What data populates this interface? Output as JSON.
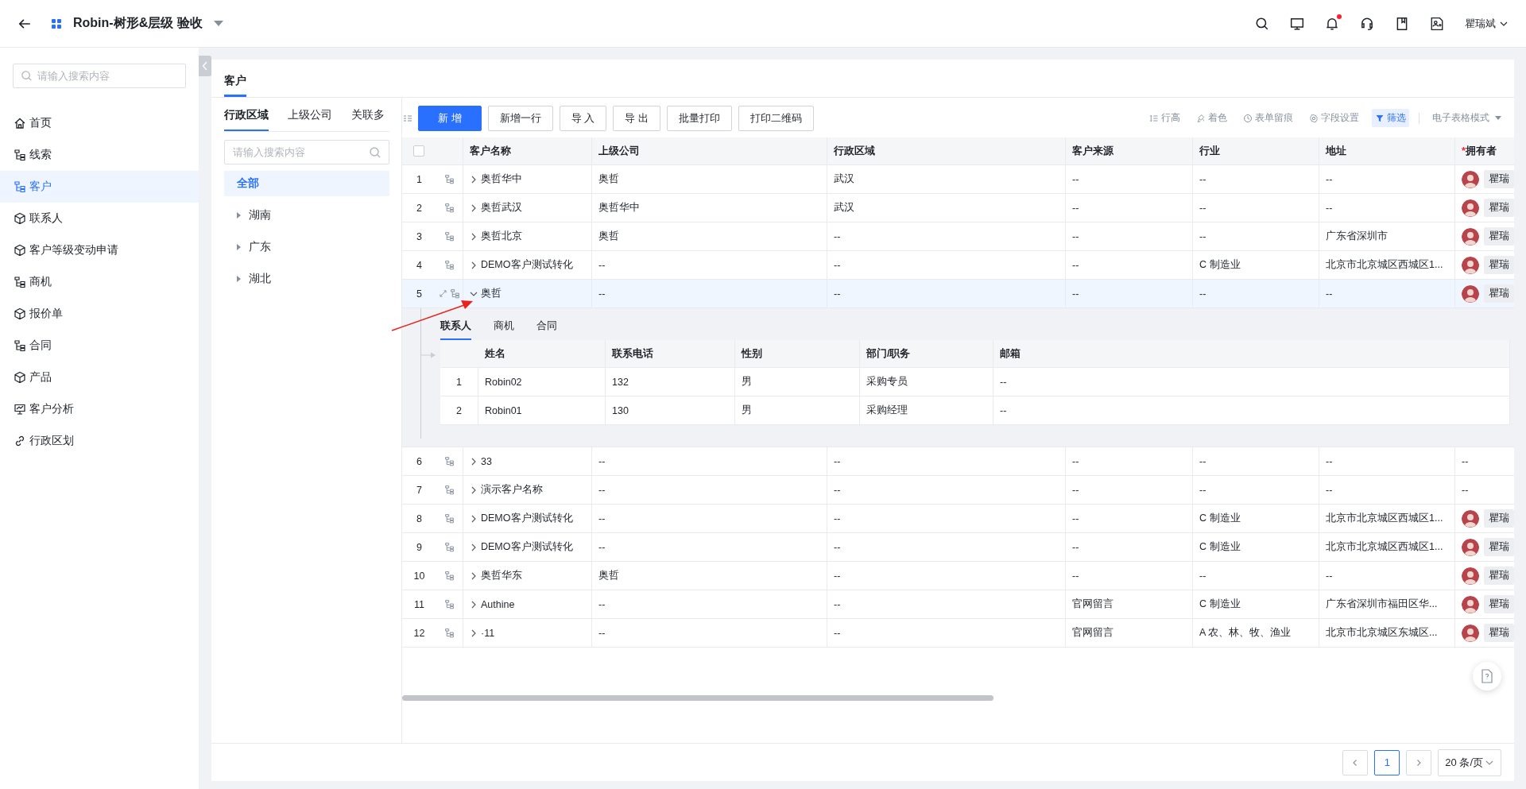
{
  "app_bar": {
    "title": "Robin-树形&层级 验收",
    "user": "瞿瑞斌",
    "notification_dot": true
  },
  "sidebar": {
    "search_placeholder": "请输入搜索内容",
    "items": [
      {
        "label": "首页",
        "kind": "home",
        "selected": false
      },
      {
        "label": "线索",
        "kind": "tree",
        "selected": false
      },
      {
        "label": "客户",
        "kind": "tree",
        "selected": true
      },
      {
        "label": "联系人",
        "kind": "cube",
        "selected": false
      },
      {
        "label": "客户等级变动申请",
        "kind": "cube",
        "selected": false
      },
      {
        "label": "商机",
        "kind": "tree",
        "selected": false
      },
      {
        "label": "报价单",
        "kind": "cube",
        "selected": false
      },
      {
        "label": "合同",
        "kind": "tree",
        "selected": false
      },
      {
        "label": "产品",
        "kind": "cube",
        "selected": false
      },
      {
        "label": "客户分析",
        "kind": "chart",
        "selected": false
      },
      {
        "label": "行政区划",
        "kind": "link",
        "selected": false
      }
    ]
  },
  "page_tabs": [
    {
      "label": "客户",
      "selected": true
    }
  ],
  "filter_panel": {
    "tabs": [
      {
        "label": "行政区域",
        "selected": true
      },
      {
        "label": "上级公司",
        "selected": false
      },
      {
        "label": "关联多",
        "selected": false
      }
    ],
    "search_placeholder": "请输入搜索内容",
    "tree": [
      {
        "label": "全部",
        "kind": "all",
        "selected": true
      },
      {
        "label": "湖南",
        "kind": "node",
        "selected": false,
        "expanded": false
      },
      {
        "label": "广东",
        "kind": "node",
        "selected": false,
        "expanded": false
      },
      {
        "label": "湖北",
        "kind": "node",
        "selected": false,
        "expanded": false
      }
    ]
  },
  "toolbar": {
    "buttons": [
      {
        "label": "新 增",
        "kind": "primary"
      },
      {
        "label": "新增一行",
        "kind": "default"
      },
      {
        "label": "导 入",
        "kind": "default"
      },
      {
        "label": "导 出",
        "kind": "default"
      },
      {
        "label": "批量打印",
        "kind": "default"
      },
      {
        "label": "打印二维码",
        "kind": "default"
      }
    ],
    "tools": [
      {
        "label": "行高",
        "kind": "lines",
        "selected": false
      },
      {
        "label": "着色",
        "kind": "brush",
        "selected": false
      },
      {
        "label": "表单留痕",
        "kind": "clock",
        "selected": false
      },
      {
        "label": "字段设置",
        "kind": "gear",
        "selected": false
      },
      {
        "label": "筛选",
        "kind": "filter",
        "selected": true
      }
    ],
    "mode": "电子表格模式"
  },
  "table": {
    "select_all_checked": false,
    "columns": [
      {
        "label": "客户名称"
      },
      {
        "label": "上级公司"
      },
      {
        "label": "行政区域"
      },
      {
        "label": "客户来源"
      },
      {
        "label": "行业"
      },
      {
        "label": "地址"
      },
      {
        "label": "拥有者",
        "required_mark": "*"
      }
    ],
    "rows": [
      {
        "index": "1",
        "expanded": false,
        "hovered": false,
        "cells": [
          "奥哲华中",
          "奥哲",
          "武汉",
          "--",
          "--",
          "--"
        ],
        "owner": {
          "avatar": true,
          "name": "瞿瑞"
        }
      },
      {
        "index": "2",
        "expanded": false,
        "hovered": false,
        "cells": [
          "奥哲武汉",
          "奥哲华中",
          "武汉",
          "--",
          "--",
          "--"
        ],
        "owner": {
          "avatar": true,
          "name": "瞿瑞"
        }
      },
      {
        "index": "3",
        "expanded": false,
        "hovered": false,
        "cells": [
          "奥哲北京",
          "奥哲",
          "--",
          "--",
          "--",
          "广东省深圳市"
        ],
        "owner": {
          "avatar": true,
          "name": "瞿瑞"
        }
      },
      {
        "index": "4",
        "expanded": false,
        "hovered": false,
        "cells": [
          "DEMO客户测试转化",
          "--",
          "--",
          "--",
          "C 制造业",
          "北京市北京城区西城区1..."
        ],
        "owner": {
          "avatar": true,
          "name": "瞿瑞"
        }
      },
      {
        "index": "5",
        "expanded": true,
        "hovered": true,
        "cells": [
          "奥哲",
          "--",
          "--",
          "--",
          "--",
          "--"
        ],
        "owner": {
          "avatar": true,
          "name": "瞿瑞"
        },
        "detail": {
          "tabs": [
            {
              "label": "联系人",
              "selected": true
            },
            {
              "label": "商机",
              "selected": false
            },
            {
              "label": "合同",
              "selected": false
            }
          ],
          "columns": [
            "姓名",
            "联系电话",
            "性别",
            "部门/职务",
            "邮箱"
          ],
          "rows": [
            {
              "index": "1",
              "cells": [
                "Robin02",
                "132",
                "男",
                "采购专员",
                "--"
              ]
            },
            {
              "index": "2",
              "cells": [
                "Robin01",
                "130",
                "男",
                "采购经理",
                "--"
              ]
            }
          ]
        }
      },
      {
        "index": "6",
        "expanded": false,
        "hovered": false,
        "cells": [
          "33",
          "--",
          "--",
          "--",
          "--",
          "--"
        ],
        "owner": {
          "avatar": false,
          "name": "--"
        }
      },
      {
        "index": "7",
        "expanded": false,
        "hovered": false,
        "cells": [
          "演示客户名称",
          "--",
          "--",
          "--",
          "--",
          "--"
        ],
        "owner": {
          "avatar": false,
          "name": "--"
        }
      },
      {
        "index": "8",
        "expanded": false,
        "hovered": false,
        "cells": [
          "DEMO客户测试转化",
          "--",
          "--",
          "--",
          "C 制造业",
          "北京市北京城区西城区1..."
        ],
        "owner": {
          "avatar": true,
          "name": "瞿瑞"
        }
      },
      {
        "index": "9",
        "expanded": false,
        "hovered": false,
        "cells": [
          "DEMO客户测试转化",
          "--",
          "--",
          "--",
          "C 制造业",
          "北京市北京城区西城区1..."
        ],
        "owner": {
          "avatar": true,
          "name": "瞿瑞"
        }
      },
      {
        "index": "10",
        "expanded": false,
        "hovered": false,
        "cells": [
          "奥哲华东",
          "奥哲",
          "--",
          "--",
          "--",
          "--"
        ],
        "owner": {
          "avatar": true,
          "name": "瞿瑞"
        }
      },
      {
        "index": "11",
        "expanded": false,
        "hovered": false,
        "cells": [
          "Authine",
          "--",
          "--",
          "官网留言",
          "C 制造业",
          "广东省深圳市福田区华..."
        ],
        "owner": {
          "avatar": true,
          "name": "瞿瑞"
        }
      },
      {
        "index": "12",
        "expanded": false,
        "hovered": false,
        "cells": [
          "·11",
          "--",
          "--",
          "官网留言",
          "A 农、林、牧、渔业",
          "北京市北京城区东城区..."
        ],
        "owner": {
          "avatar": true,
          "name": "瞿瑞"
        }
      }
    ]
  },
  "pagination": {
    "pages": [
      {
        "label": "1",
        "selected": true
      }
    ],
    "page_size": "20 条/页"
  }
}
